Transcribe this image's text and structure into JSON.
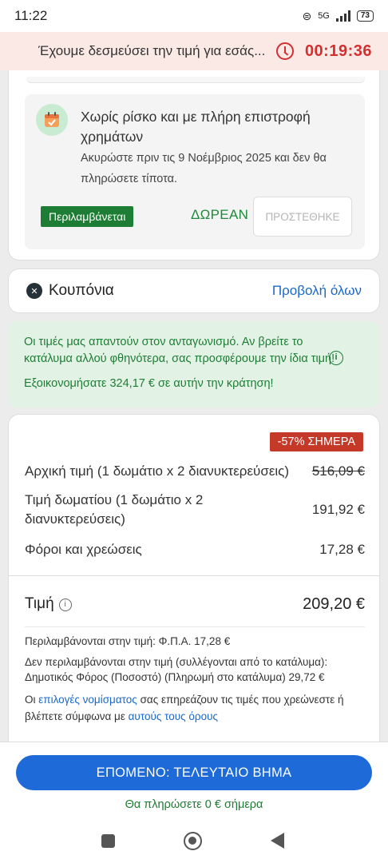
{
  "status": {
    "time": "11:22",
    "network": "5G",
    "battery": "73"
  },
  "banner": {
    "text": "Έχουμε δεσμεύσει την τιμή για εσάς...",
    "timer": "00:19:36"
  },
  "risk": {
    "title": "Χωρίς ρίσκο και με πλήρη επιστροφή χρημάτων",
    "desc": "Ακυρώστε πριν τις 9 Νοέμβριος 2025 και δεν θα πληρώσετε τίποτα.",
    "badge": "Περιλαμβάνεται",
    "price": "ΔΩΡΕΑΝ",
    "button": "ΠΡΟΣΤΕΘΗΚΕ"
  },
  "coupons": {
    "title": "Κουπόνια",
    "link": "Προβολή όλων"
  },
  "promo": {
    "message": "Οι τιμές μας απαντούν στον ανταγωνισμό. Αν βρείτε το κατάλυμα αλλού φθηνότερα, σας προσφέρουμε την ίδια τιμή!",
    "savings": "Εξοικονομήσατε 324,17 € σε αυτήν την κράτηση!"
  },
  "pricing": {
    "discount_badge": "-57% ΣΗΜΕΡΑ",
    "original_label": "Αρχική τιμή (1 δωμάτιο x 2 διανυκτερεύσεις)",
    "original_value": "516,09 €",
    "room_label": "Τιμή δωματίου (1 δωμάτιο x 2 διανυκτερεύσεις)",
    "room_value": "191,92 €",
    "taxes_label": "Φόροι και χρεώσεις",
    "taxes_value": "17,28 €",
    "total_label": "Τιμή",
    "total_value": "209,20 €",
    "included_note": "Περιλαμβάνονται στην τιμή: Φ.Π.Α. 17,28 €",
    "excluded_note": "Δεν περιλαμβάνονται στην τιμή (συλλέγονται από το κατάλυμα): Δημοτικός Φόρος (Ποσοστό) (Πληρωμή στο κατάλυμα) 29,72 €",
    "currency_prefix": "Οι",
    "currency_link": "επιλογές νομίσματος",
    "currency_mid": "σας επηρεάζουν τις τιμές που χρεώνεστε ή βλέπετε σύμφωνα με",
    "terms_link": "αυτούς τους όρους"
  },
  "footer": {
    "cta": "ΕΠΟΜΕΝΟ: ΤΕΛΕΥΤΑΙΟ ΒΗΜΑ",
    "note": "Θα πληρώσετε 0 € σήμερα"
  },
  "colors": {
    "accent": "#1d6ad8",
    "green": "#1e7d34",
    "red": "#d32f2f"
  },
  "icons": [
    "calendar-check-icon",
    "coupon-icon",
    "info-icon",
    "clock-icon"
  ]
}
